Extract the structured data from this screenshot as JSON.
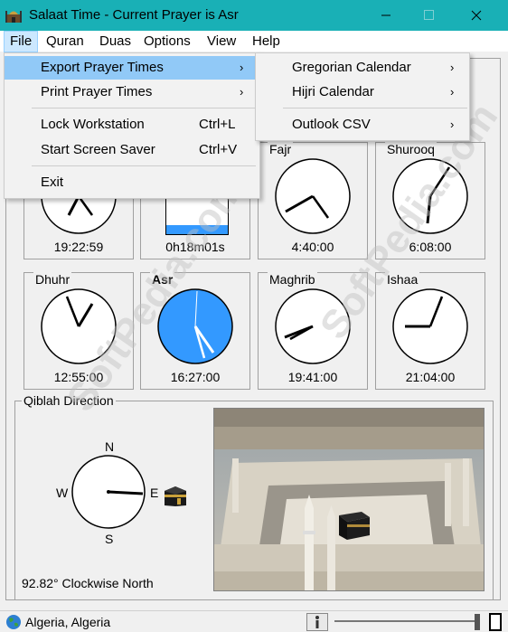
{
  "window": {
    "title": "Salaat Time - Current Prayer is Asr",
    "icons": {
      "app": "mosque-icon",
      "minimize": "minimize-icon",
      "maximize": "maximize-icon",
      "close": "close-icon"
    }
  },
  "menubar": {
    "items": [
      "File",
      "Quran",
      "Duas",
      "Options",
      "View",
      "Help"
    ]
  },
  "file_menu": {
    "items": [
      {
        "label": "Export Prayer Times",
        "submenu": true,
        "highlighted": true
      },
      {
        "label": "Print Prayer Times",
        "submenu": true
      },
      {
        "label": "Lock Workstation",
        "shortcut": "Ctrl+L"
      },
      {
        "label": "Start Screen Saver",
        "shortcut": "Ctrl+V"
      },
      {
        "label": "Exit"
      }
    ]
  },
  "export_submenu": {
    "items": [
      {
        "label": "Gregorian Calendar",
        "submenu": true
      },
      {
        "label": "Hijri Calendar",
        "submenu": true
      },
      {
        "label": "Outlook CSV",
        "submenu": true
      }
    ]
  },
  "clocks": {
    "current_time": {
      "label": "",
      "time": "19:22:59"
    },
    "remaining": {
      "label": "",
      "time": "0h18m01s",
      "progress": 0.15
    },
    "fajr": {
      "label": "Fajr",
      "time": "4:40:00"
    },
    "shurooq": {
      "label": "Shurooq",
      "time": "6:08:00"
    },
    "dhuhr": {
      "label": "Dhuhr",
      "time": "12:55:00"
    },
    "asr": {
      "label": "Asr",
      "time": "16:27:00",
      "active": true
    },
    "maghrib": {
      "label": "Maghrib",
      "time": "19:41:00"
    },
    "ishaa": {
      "label": "Ishaa",
      "time": "21:04:00"
    }
  },
  "qibla": {
    "group_label": "Qiblah Direction",
    "north": "N",
    "south": "S",
    "east": "E",
    "west": "W",
    "degrees_text": "92.82° Clockwise North",
    "kaaba_icon": "kaaba-icon"
  },
  "photo": {
    "name": "masjid-al-haram-photo"
  },
  "statusbar": {
    "location": "Algeria, Algeria",
    "globe_icon": "globe-icon",
    "info_icon": "info-icon"
  },
  "colors": {
    "titlebar": "#19b0b6",
    "menu_highlight": "#91c9f7",
    "active_clock": "#3399ff"
  },
  "watermark": "SoftPedia.com"
}
